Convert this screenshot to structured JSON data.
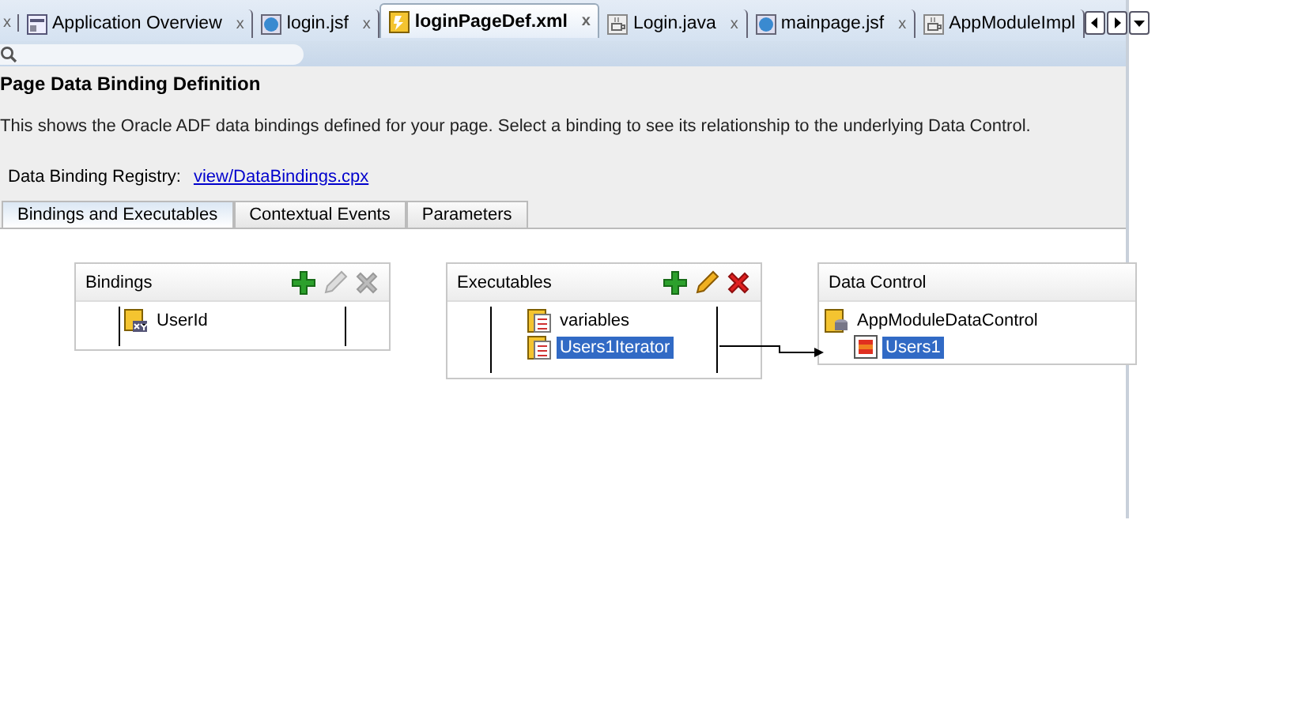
{
  "editor_tabs": {
    "close_button": "x",
    "tabs": [
      {
        "label": "Application Overview",
        "kind": "overview",
        "close": "x",
        "selected": false
      },
      {
        "label": "login.jsf",
        "kind": "web",
        "close": "x",
        "selected": false
      },
      {
        "label": "loginPageDef.xml",
        "kind": "pagedef",
        "close": "x",
        "selected": true
      },
      {
        "label": "Login.java",
        "kind": "java",
        "close": "x",
        "selected": false
      },
      {
        "label": "mainpage.jsf",
        "kind": "web",
        "close": "x",
        "selected": false
      },
      {
        "label": "AppModuleImpl",
        "kind": "java",
        "selected": false
      }
    ]
  },
  "page": {
    "title": "Page Data Binding Definition",
    "description": "This shows the Oracle ADF data bindings defined for your page. Select a binding to see its relationship to the underlying Data Control.",
    "registry_label": "Data Binding Registry:",
    "registry_link": "view/DataBindings.cpx"
  },
  "tabs": [
    {
      "label": "Bindings and Executables",
      "selected": true
    },
    {
      "label": "Contextual Events",
      "selected": false
    },
    {
      "label": "Parameters",
      "selected": false
    }
  ],
  "panels": [
    {
      "title": "Bindings",
      "tools": [
        {
          "kind": "add",
          "disabled": false
        },
        {
          "kind": "edit",
          "disabled": true
        },
        {
          "kind": "delete",
          "disabled": true
        }
      ],
      "items": [
        {
          "label": "UserId",
          "kind": "attribute",
          "selected": false
        }
      ]
    },
    {
      "title": "Executables",
      "tools": [
        {
          "kind": "add",
          "disabled": false
        },
        {
          "kind": "edit",
          "disabled": false
        },
        {
          "kind": "delete",
          "disabled": false
        }
      ],
      "items": [
        {
          "label": "variables",
          "kind": "iterator",
          "selected": false
        },
        {
          "label": "Users1Iterator",
          "kind": "iterator",
          "selected": true
        }
      ]
    },
    {
      "title": "Data Control",
      "items": [
        {
          "label": "AppModuleDataControl",
          "kind": "datacontrol",
          "selected": false,
          "children": [
            {
              "label": "Users1",
              "kind": "collection",
              "selected": true
            }
          ]
        }
      ]
    }
  ]
}
